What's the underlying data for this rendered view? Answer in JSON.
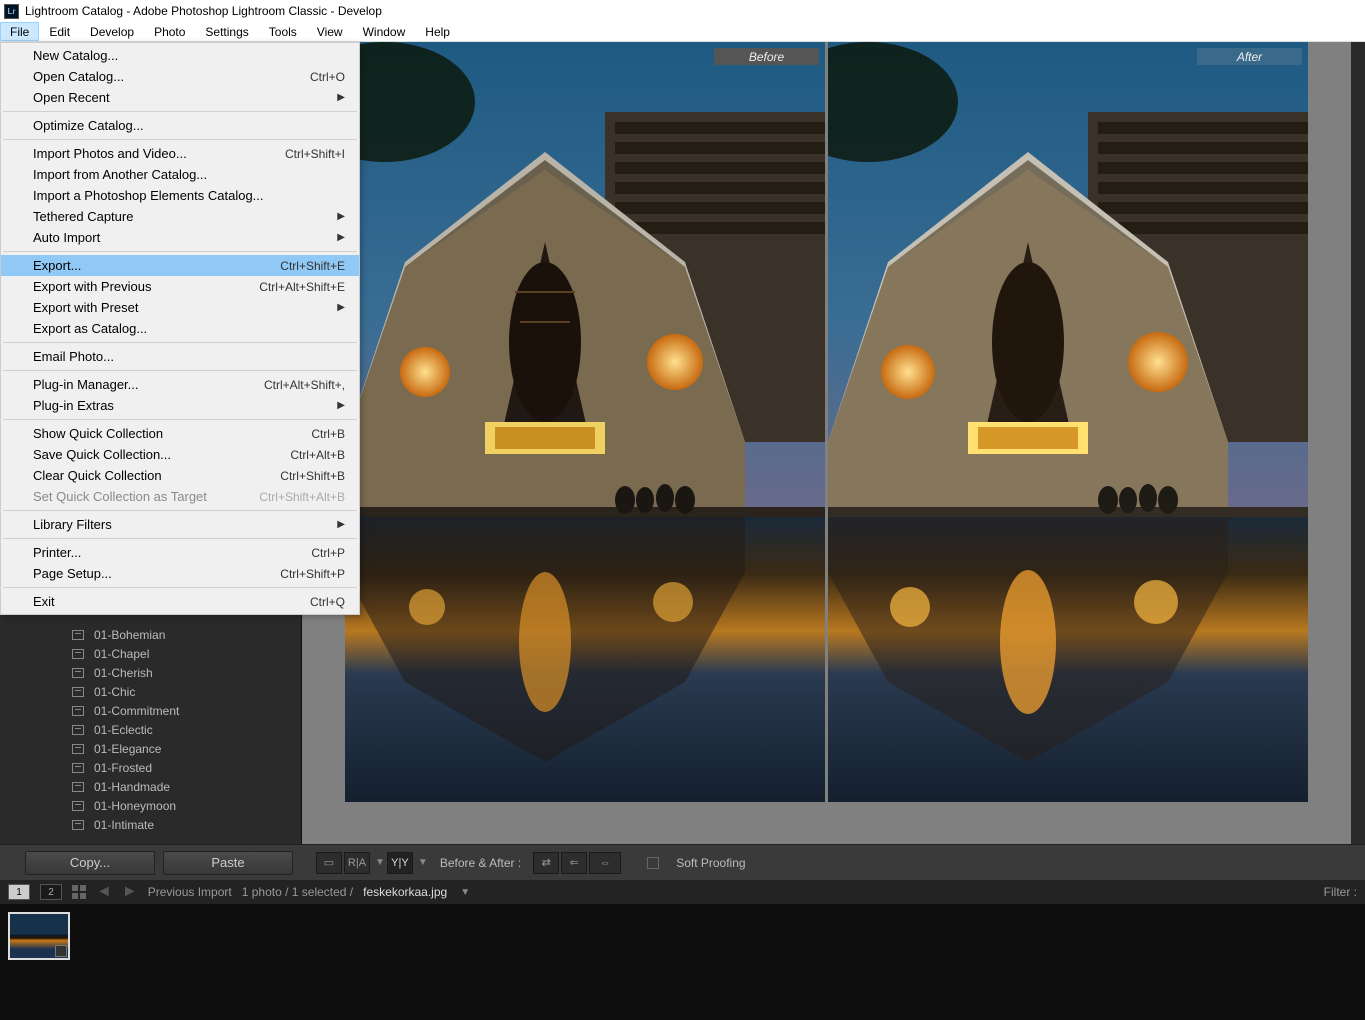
{
  "title": "Lightroom Catalog - Adobe Photoshop Lightroom Classic - Develop",
  "menubar": [
    "File",
    "Edit",
    "Develop",
    "Photo",
    "Settings",
    "Tools",
    "View",
    "Window",
    "Help"
  ],
  "file_menu": [
    {
      "t": "item",
      "label": "New Catalog..."
    },
    {
      "t": "item",
      "label": "Open Catalog...",
      "short": "Ctrl+O"
    },
    {
      "t": "item",
      "label": "Open Recent",
      "sub": true
    },
    {
      "t": "sep"
    },
    {
      "t": "item",
      "label": "Optimize Catalog..."
    },
    {
      "t": "sep"
    },
    {
      "t": "item",
      "label": "Import Photos and Video...",
      "short": "Ctrl+Shift+I"
    },
    {
      "t": "item",
      "label": "Import from Another Catalog..."
    },
    {
      "t": "item",
      "label": "Import a Photoshop Elements Catalog..."
    },
    {
      "t": "item",
      "label": "Tethered Capture",
      "sub": true
    },
    {
      "t": "item",
      "label": "Auto Import",
      "sub": true
    },
    {
      "t": "sep"
    },
    {
      "t": "item",
      "label": "Export...",
      "short": "Ctrl+Shift+E",
      "hl": true
    },
    {
      "t": "item",
      "label": "Export with Previous",
      "short": "Ctrl+Alt+Shift+E"
    },
    {
      "t": "item",
      "label": "Export with Preset",
      "sub": true
    },
    {
      "t": "item",
      "label": "Export as Catalog..."
    },
    {
      "t": "sep"
    },
    {
      "t": "item",
      "label": "Email Photo..."
    },
    {
      "t": "sep"
    },
    {
      "t": "item",
      "label": "Plug-in Manager...",
      "short": "Ctrl+Alt+Shift+,"
    },
    {
      "t": "item",
      "label": "Plug-in Extras",
      "sub": true
    },
    {
      "t": "sep"
    },
    {
      "t": "item",
      "label": "Show Quick Collection",
      "short": "Ctrl+B"
    },
    {
      "t": "item",
      "label": "Save Quick Collection...",
      "short": "Ctrl+Alt+B"
    },
    {
      "t": "item",
      "label": "Clear Quick Collection",
      "short": "Ctrl+Shift+B"
    },
    {
      "t": "item",
      "label": "Set Quick Collection as Target",
      "short": "Ctrl+Shift+Alt+B",
      "disabled": true
    },
    {
      "t": "sep"
    },
    {
      "t": "item",
      "label": "Library Filters",
      "sub": true
    },
    {
      "t": "sep"
    },
    {
      "t": "item",
      "label": "Printer...",
      "short": "Ctrl+P"
    },
    {
      "t": "item",
      "label": "Page Setup...",
      "short": "Ctrl+Shift+P"
    },
    {
      "t": "sep"
    },
    {
      "t": "item",
      "label": "Exit",
      "short": "Ctrl+Q"
    }
  ],
  "presets": [
    "01-Bohemian",
    "01-Chapel",
    "01-Cherish",
    "01-Chic",
    "01-Commitment",
    "01-Eclectic",
    "01-Elegance",
    "01-Frosted",
    "01-Handmade",
    "01-Honeymoon",
    "01-Intimate"
  ],
  "badges": {
    "before": "Before",
    "after": "After"
  },
  "toolbar": {
    "copy": "Copy...",
    "paste": "Paste",
    "ba_label": "Before & After :",
    "soft": "Soft Proofing"
  },
  "filmstrip": {
    "screen1": "1",
    "screen2": "2",
    "crumb": "Previous Import",
    "count": "1 photo / 1 selected /",
    "file": "feskekorkaa.jpg",
    "filter": "Filter :"
  }
}
